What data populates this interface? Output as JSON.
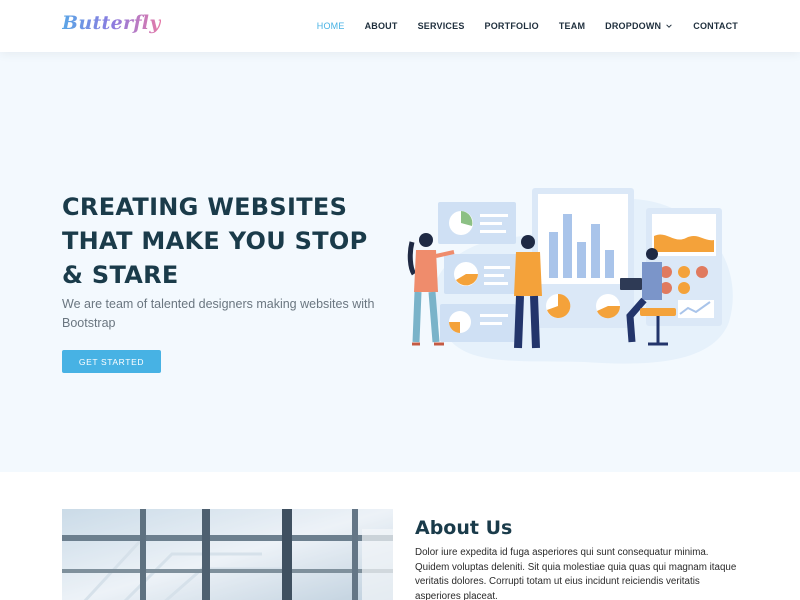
{
  "header": {
    "logo": "Butterfly",
    "nav": [
      {
        "label": "HOME",
        "active": true
      },
      {
        "label": "ABOUT",
        "active": false
      },
      {
        "label": "SERVICES",
        "active": false
      },
      {
        "label": "PORTFOLIO",
        "active": false
      },
      {
        "label": "TEAM",
        "active": false
      },
      {
        "label": "DROPDOWN",
        "active": false,
        "has_dropdown": true
      },
      {
        "label": "CONTACT",
        "active": false
      }
    ]
  },
  "hero": {
    "title": "CREATING WEBSITES THAT MAKE YOU STOP & STARE",
    "subtitle": "We are team of talented designers making websites with Bootstrap",
    "cta_label": "GET STARTED"
  },
  "about": {
    "title": "About Us",
    "text": "Dolor iure expedita id fuga asperiores qui sunt consequatur minima. Quidem voluptas deleniti. Sit quia molestiae quia quas qui magnam itaque veritatis dolores. Corrupti totam ut eius incidunt reiciendis veritatis asperiores placeat."
  },
  "colors": {
    "accent": "#47b2e4",
    "heading": "#1a3b4a",
    "hero_bg": "#f3f9fe",
    "illustration_orange": "#f4a23a",
    "illustration_blue": "#a9c4ea"
  }
}
